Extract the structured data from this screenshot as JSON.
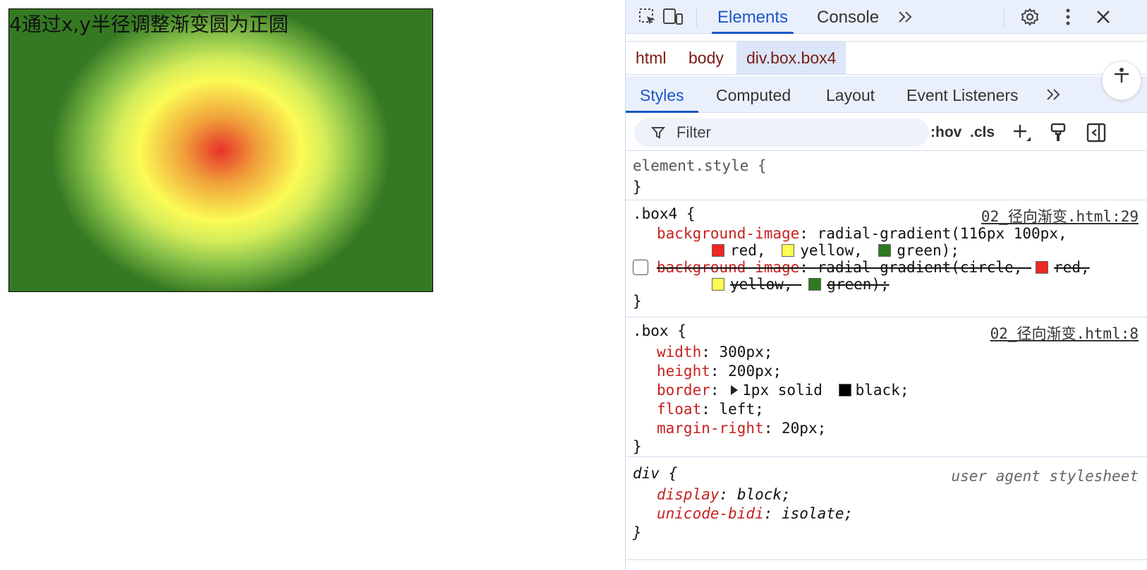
{
  "preview": {
    "caption": "4通过x,y半径调整渐变圆为正圆"
  },
  "devtools": {
    "tabs": [
      "Elements",
      "Console"
    ],
    "active_tab": "Elements",
    "breadcrumb": [
      "html",
      "body",
      "div.box.box4"
    ],
    "subtabs": [
      "Styles",
      "Computed",
      "Layout",
      "Event Listeners"
    ],
    "filter_placeholder": "Filter",
    "hov_label": ":hov",
    "cls_label": ".cls",
    "rules": {
      "element_style": {
        "selector": "element.style {",
        "close": "}"
      },
      "box4": {
        "selector": ".box4 {",
        "source": "02_径向渐变.html:29",
        "decl1_prop": "background-image",
        "decl1_value_a": "radial-gradient(116px 100px,",
        "decl1_value_b_red": "red,",
        "decl1_value_b_yellow": "yellow,",
        "decl1_value_b_green": "green);",
        "decl2_prop": "background-image",
        "decl2_value_a": "radial-gradient(circle,",
        "decl2_value_a_red": "red,",
        "decl2_value_b_yellow": "yellow,",
        "decl2_value_b_green": "green);",
        "close": "}"
      },
      "box": {
        "selector": ".box {",
        "source": "02_径向渐变.html:8",
        "decls": [
          {
            "prop": "width",
            "value": "300px;"
          },
          {
            "prop": "height",
            "value": "200px;"
          },
          {
            "prop": "border",
            "value_a": "1px solid",
            "value_b": "black;"
          },
          {
            "prop": "float",
            "value": "left;"
          },
          {
            "prop": "margin-right",
            "value": "20px;"
          }
        ],
        "close": "}"
      },
      "div_ua": {
        "selector": "div {",
        "source": "user agent stylesheet",
        "decls": [
          {
            "prop": "display",
            "value": "block;"
          },
          {
            "prop": "unicode-bidi",
            "value": "isolate;"
          }
        ],
        "close": "}"
      }
    },
    "colors": {
      "red": "#ee2722",
      "yellow": "#fcfc52",
      "green": "#2f7a1f",
      "black": "#000000",
      "accent": "#1a56c8"
    }
  }
}
